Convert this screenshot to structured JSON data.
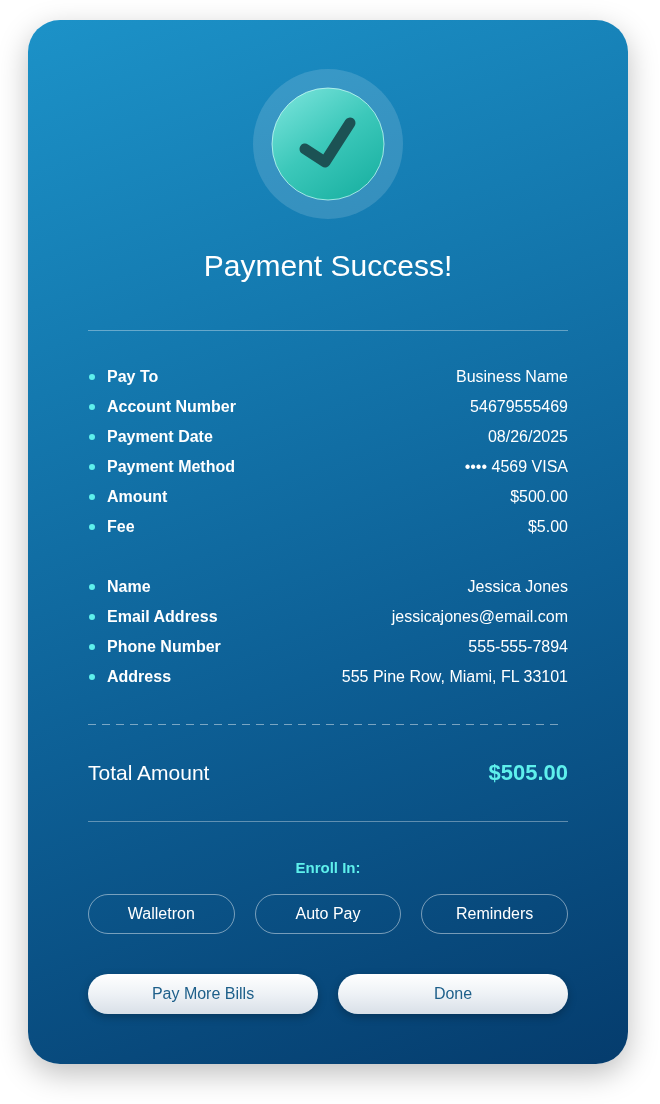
{
  "status": {
    "title": "Payment Success!"
  },
  "detail_groups": [
    {
      "items": [
        {
          "label": "Pay To",
          "value": "Business Name"
        },
        {
          "label": "Account Number",
          "value": "54679555469"
        },
        {
          "label": "Payment Date",
          "value": "08/26/2025"
        },
        {
          "label": "Payment Method",
          "value": "•••• 4569 VISA"
        },
        {
          "label": "Amount",
          "value": "$500.00"
        },
        {
          "label": "Fee",
          "value": "$5.00"
        }
      ]
    },
    {
      "items": [
        {
          "label": "Name",
          "value": "Jessica Jones"
        },
        {
          "label": "Email Address",
          "value": "jessicajones@email.com"
        },
        {
          "label": "Phone Number",
          "value": "555-555-7894"
        },
        {
          "label": "Address",
          "value": "555 Pine Row, Miami, FL 33101"
        }
      ]
    }
  ],
  "total": {
    "label": "Total Amount",
    "value": "$505.00"
  },
  "enroll": {
    "label": "Enroll In:",
    "options": [
      "Walletron",
      "Auto Pay",
      "Reminders"
    ]
  },
  "actions": [
    "Pay More Bills",
    "Done"
  ]
}
